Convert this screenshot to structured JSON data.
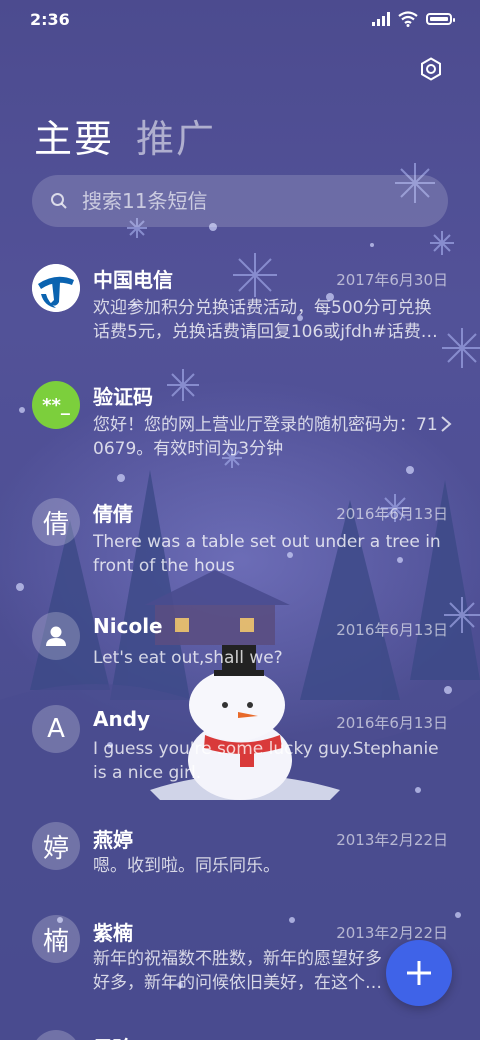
{
  "status_bar": {
    "time": "2:36"
  },
  "tabs": [
    {
      "label": "主要",
      "active": true
    },
    {
      "label": "推广",
      "active": false
    }
  ],
  "search": {
    "placeholder": "搜索11条短信"
  },
  "conversations": [
    {
      "name": "中国电信",
      "date": "2017年6月30日",
      "preview": "欢迎参加积分兑换话费活动，每500分可兑换话费5元，兑换话费请回复106或jfdh#话费…",
      "avatar": "china-telecom-logo"
    },
    {
      "name": "验证码",
      "date": "",
      "preview": "您好！您的网上营业厅登录的随机密码为：710679。有效时间为3分钟",
      "avatar_text": "**_",
      "avatar_color": "#7ccf3c"
    },
    {
      "name": "倩倩",
      "date": "2016年6月13日",
      "preview": "There was a table set out under a tree in front of the hous",
      "avatar_text": "倩"
    },
    {
      "name": "Nicole",
      "date": "2016年6月13日",
      "preview": "Let's eat out,shall we?",
      "avatar": "person-icon"
    },
    {
      "name": "Andy",
      "date": "2016年6月13日",
      "preview": "I guess you're some lucky guy.Stephanie is a nice girl.",
      "avatar_text": "A"
    },
    {
      "name": "燕婷",
      "date": "2013年2月22日",
      "preview": "嗯。收到啦。同乐同乐。",
      "avatar_text": "婷"
    },
    {
      "name": "紫楠",
      "date": "2013年2月22日",
      "preview": "新年的祝福数不胜数，新年的愿望好多好多，新年的问候依旧美好，在这个温馨的时刻…",
      "avatar_text": "楠"
    },
    {
      "name": "子玲",
      "date": "",
      "preview": "",
      "avatar_text": ""
    }
  ],
  "colors": {
    "fab": "#3f63e8",
    "background": "#4f4f95",
    "verify_avatar": "#7ccf3c"
  }
}
